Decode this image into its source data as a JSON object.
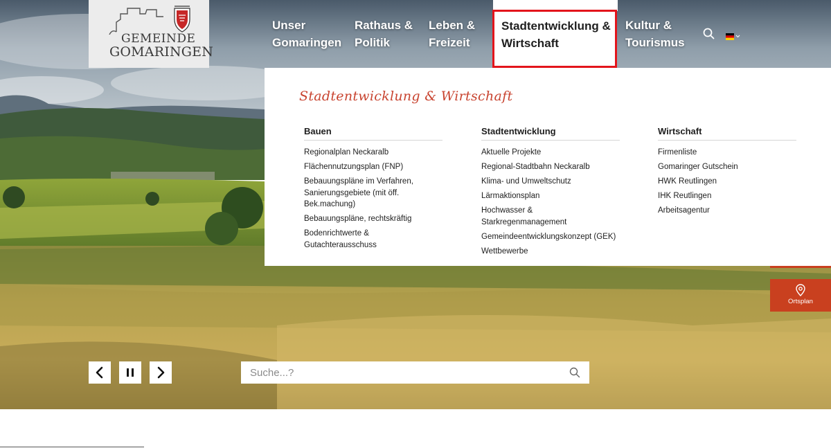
{
  "logo": {
    "line1": "GEMEINDE",
    "line2": "GOMARINGEN"
  },
  "nav": {
    "items": [
      {
        "line1": "Unser",
        "line2": "Gomaringen"
      },
      {
        "line1": "Rathaus &",
        "line2": "Politik"
      },
      {
        "line1": "Leben &",
        "line2": "Freizeit"
      },
      {
        "line1": "Stadtentwicklung &",
        "line2": "Wirtschaft"
      },
      {
        "line1": "Kultur &",
        "line2": "Tourismus"
      }
    ],
    "search_icon": "search-icon",
    "language_icon": "german-flag-icon"
  },
  "mega_menu": {
    "title": "Stadtentwicklung & Wirtschaft",
    "columns": [
      {
        "heading": "Bauen",
        "links": [
          "Regionalplan Neckaralb",
          "Flächennutzungsplan (FNP)",
          "Bebauungspläne im Verfahren, Sanierungsgebiete (mit öff. Bek.machung)",
          "Bebauungspläne, rechtskräftig",
          "Bodenrichtwerte & Gutachterausschuss"
        ]
      },
      {
        "heading": "Stadtentwicklung",
        "links": [
          "Aktuelle Projekte",
          "Regional-Stadtbahn Neckaralb",
          "Klima- und Umweltschutz",
          "Lärmaktionsplan",
          "Hochwasser & Starkregenmanagement",
          "Gemeindeentwicklungskonzept (GEK)",
          "Wettbewerbe"
        ]
      },
      {
        "heading": "Wirtschaft",
        "links": [
          "Firmenliste",
          "Gomaringer Gutschein",
          "HWK Reutlingen",
          "IHK Reutlingen",
          "Arbeitsagentur"
        ]
      }
    ]
  },
  "ortsplan": {
    "label": "Ortsplan",
    "icon": "map-pin-icon"
  },
  "slider": {
    "prev_icon": "chevron-left-icon",
    "pause_icon": "pause-icon",
    "next_icon": "chevron-right-icon"
  },
  "search": {
    "placeholder": "Suche...?",
    "icon": "search-icon"
  },
  "colors": {
    "accent_red": "#e3141b",
    "ortsplan_orange": "#c9401f",
    "menu_title": "#c8432f"
  }
}
